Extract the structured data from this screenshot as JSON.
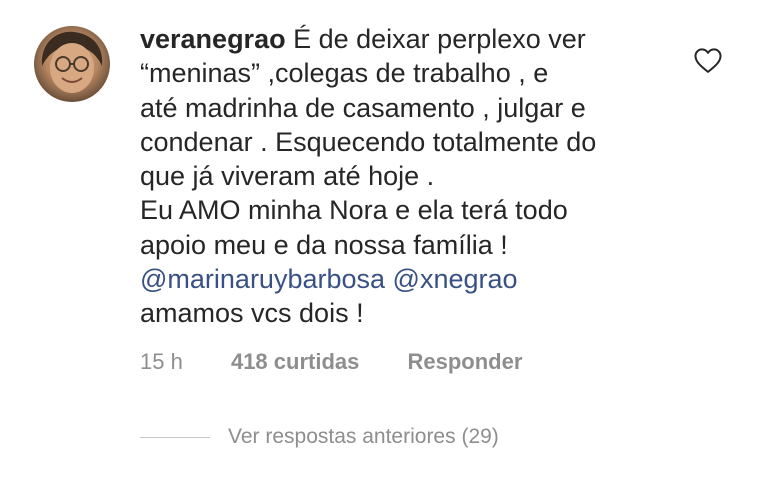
{
  "comment": {
    "username": "veranegrao",
    "lines": [
      "É de deixar perplexo ver",
      "“meninas” ,colegas de trabalho , e",
      "até madrinha de casamento , julgar e",
      "condenar . Esquecendo totalmente do",
      "que já viveram até hoje .",
      "Eu AMO minha Nora e ela terá todo",
      "apoio meu e da nossa família !"
    ],
    "mentions": [
      "@marinaruybarbosa",
      "@xnegrao"
    ],
    "closing": "amamos vcs dois !",
    "icons": {
      "like": "heart-icon",
      "avatar": "profile-avatar"
    }
  },
  "meta": {
    "time": "15 h",
    "likes": "418 curtidas",
    "reply": "Responder"
  },
  "replies": {
    "label": "Ver respostas anteriores (29)"
  },
  "colors": {
    "text": "#262626",
    "secondary": "#8e8e8e",
    "mention": "#385185",
    "divider": "#c7c7c7"
  }
}
